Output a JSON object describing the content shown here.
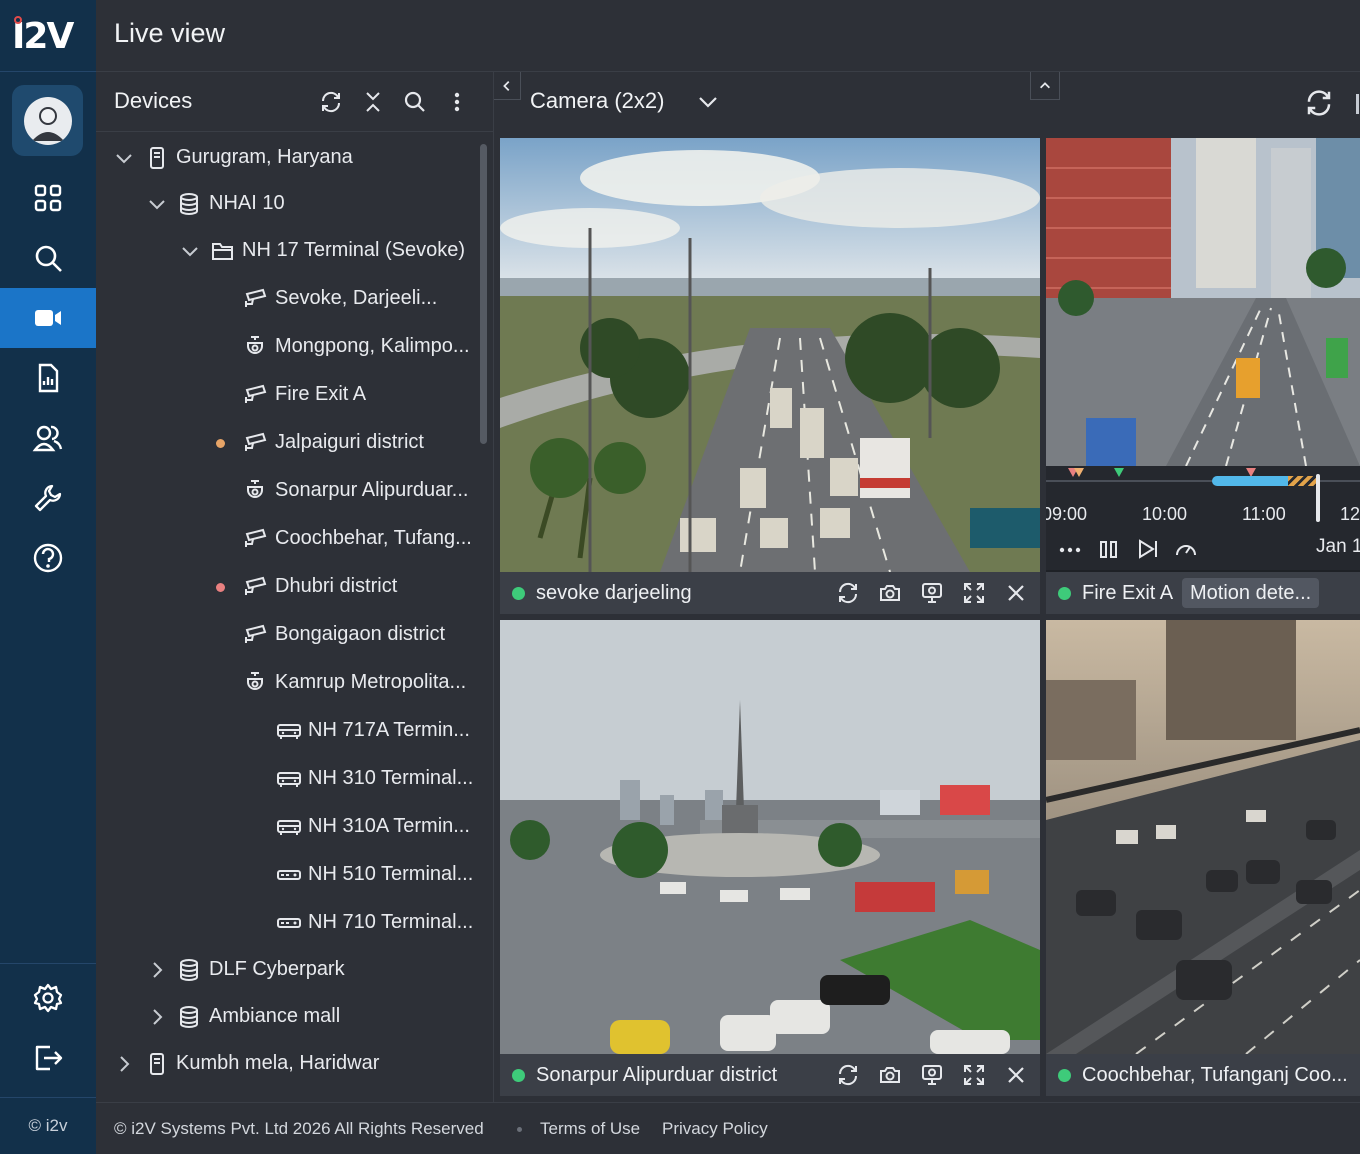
{
  "app": {
    "logo_text": "I2V",
    "page_title": "Live view",
    "rail_footer": "© i2v"
  },
  "rail": {
    "items": [
      {
        "icon": "grid-icon",
        "label": ""
      },
      {
        "icon": "search-icon",
        "label": ""
      },
      {
        "icon": "video-camera-icon",
        "label": "",
        "active": true
      },
      {
        "icon": "report-icon",
        "label": ""
      },
      {
        "icon": "users-icon",
        "label": ""
      },
      {
        "icon": "wrench-icon",
        "label": ""
      },
      {
        "icon": "help-icon",
        "label": ""
      }
    ],
    "bottom": [
      "gear-icon",
      "logout-icon"
    ]
  },
  "devices": {
    "title": "Devices",
    "tree": [
      {
        "label": "Gurugram, Haryana",
        "level": 0,
        "icon": "site-icon",
        "expanded": true
      },
      {
        "label": "NHAI 10",
        "level": 1,
        "icon": "server-icon",
        "expanded": true
      },
      {
        "label": "NH 17 Terminal (Sevoke)",
        "level": 2,
        "icon": "folder-icon",
        "expanded": true
      },
      {
        "label": "Sevoke, Darjeeli...",
        "level": 3,
        "icon": "bullet-camera-icon"
      },
      {
        "label": "Mongpong, Kalimpo...",
        "level": 3,
        "icon": "dome-camera-icon"
      },
      {
        "label": "Fire Exit A",
        "level": 3,
        "icon": "bullet-camera-icon"
      },
      {
        "label": "Jalpaiguri district",
        "level": 3,
        "icon": "bullet-camera-icon",
        "status": "#e7a467"
      },
      {
        "label": "Sonarpur Alipurduar...",
        "level": 3,
        "icon": "dome-camera-icon"
      },
      {
        "label": "Coochbehar, Tufang...",
        "level": 3,
        "icon": "bullet-camera-icon"
      },
      {
        "label": "Dhubri district",
        "level": 3,
        "icon": "bullet-camera-icon",
        "status": "#e98080"
      },
      {
        "label": "Bongaigaon district",
        "level": 3,
        "icon": "bullet-camera-icon"
      },
      {
        "label": "Kamrup Metropolita...",
        "level": 3,
        "icon": "dome-camera-icon"
      },
      {
        "label": "NH 717A Termin...",
        "level": 4,
        "icon": "nvr-icon"
      },
      {
        "label": "NH 310 Terminal...",
        "level": 4,
        "icon": "nvr-icon"
      },
      {
        "label": "NH 310A Termin...",
        "level": 4,
        "icon": "nvr-icon"
      },
      {
        "label": "NH 510 Terminal...",
        "level": 4,
        "icon": "encoder-icon"
      },
      {
        "label": "NH 710 Terminal...",
        "level": 4,
        "icon": "encoder-icon"
      },
      {
        "label": "DLF Cyberpark",
        "level": 1,
        "icon": "server-icon",
        "expanded": false
      },
      {
        "label": "Ambiance mall",
        "level": 1,
        "icon": "server-icon",
        "expanded": false
      },
      {
        "label": "Kumbh mela, Haridwar",
        "level": 0,
        "icon": "site-icon",
        "expanded": false
      }
    ]
  },
  "camera": {
    "layout_label": "Camera (2x2)",
    "tiles": [
      {
        "name": "sevoke darjeeling",
        "status_color": "#3ecb7a"
      },
      {
        "name": "Fire Exit A",
        "status_color": "#3ecb7a",
        "badge": "Motion dete..."
      },
      {
        "name": "Sonarpur Alipurduar district",
        "status_color": "#3ecb7a"
      },
      {
        "name": "Coochbehar, Tufanganj Coo...",
        "status_color": "#3ecb7a"
      }
    ],
    "timeline": {
      "ticks": [
        "09:00",
        "10:00",
        "11:00",
        "12:"
      ],
      "date": "Jan 1"
    }
  },
  "footer": {
    "copyright": "© i2V Systems Pvt. Ltd 2026 All Rights Reserved",
    "terms": "Terms of Use",
    "privacy": "Privacy Policy"
  }
}
